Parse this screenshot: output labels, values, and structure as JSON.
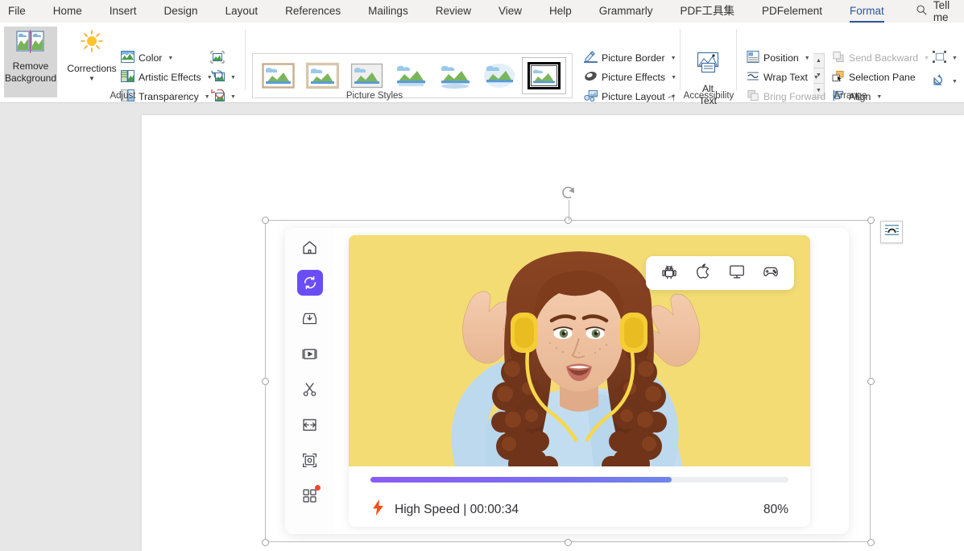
{
  "menubar": {
    "items": [
      {
        "label": "File",
        "active": false
      },
      {
        "label": "Home",
        "active": false
      },
      {
        "label": "Insert",
        "active": false
      },
      {
        "label": "Design",
        "active": false
      },
      {
        "label": "Layout",
        "active": false
      },
      {
        "label": "References",
        "active": false
      },
      {
        "label": "Mailings",
        "active": false
      },
      {
        "label": "Review",
        "active": false
      },
      {
        "label": "View",
        "active": false
      },
      {
        "label": "Help",
        "active": false
      },
      {
        "label": "Grammarly",
        "active": false
      },
      {
        "label": "PDF工具集",
        "active": false
      },
      {
        "label": "PDFelement",
        "active": false
      },
      {
        "label": "Format",
        "active": true
      }
    ],
    "tell_me": "Tell me",
    "active_accent": "#2b579a"
  },
  "ribbon": {
    "adjust": {
      "group_label": "Adjust",
      "remove_background": "Remove\nBackground",
      "remove_background_line1": "Remove",
      "remove_background_line2": "Background",
      "corrections": "Corrections",
      "color": "Color",
      "artistic_effects": "Artistic Effects",
      "transparency": "Transparency"
    },
    "picture_styles": {
      "group_label": "Picture Styles",
      "selected_index": 6,
      "thumb_count": 7,
      "picture_border": "Picture Border",
      "picture_effects": "Picture Effects",
      "picture_layout": "Picture Layout"
    },
    "accessibility": {
      "group_label": "Accessibility",
      "alt_text_line1": "Alt",
      "alt_text_line2": "Text"
    },
    "arrange": {
      "group_label": "Arrange",
      "position": "Position",
      "wrap_text": "Wrap Text",
      "bring_forward": "Bring Forward",
      "send_backward": "Send Backward",
      "selection_pane": "Selection Pane",
      "align": "Align"
    }
  },
  "picture": {
    "sidebar_items": [
      {
        "name": "home",
        "selected": false,
        "badge": false
      },
      {
        "name": "convert",
        "selected": true,
        "badge": false
      },
      {
        "name": "download",
        "selected": false,
        "badge": false
      },
      {
        "name": "video",
        "selected": false,
        "badge": false
      },
      {
        "name": "cut",
        "selected": false,
        "badge": false
      },
      {
        "name": "compress",
        "selected": false,
        "badge": false
      },
      {
        "name": "crop",
        "selected": false,
        "badge": false
      },
      {
        "name": "toolbox",
        "selected": false,
        "badge": true
      }
    ],
    "platform_bar": [
      "android",
      "apple",
      "monitor",
      "gamepad"
    ],
    "progress": {
      "speed_label": "High Speed",
      "separator": "|",
      "elapsed": "00:00:34",
      "status_text": "High Speed | 00:00:34",
      "percent_label": "80%",
      "percent_value": 80,
      "bar_fill_ratio": 72,
      "fill_color_start": "#8b5cf6",
      "fill_color_end": "#6f86ea",
      "track_color": "#eceef1"
    },
    "accent_color": "#6b4df6",
    "photo_background": "#f3dc73",
    "badge_color": "#f5452f"
  },
  "selection": {
    "handle_count": 8,
    "rotate_handle": "rotate-handle",
    "layout_options": "layout-options"
  }
}
